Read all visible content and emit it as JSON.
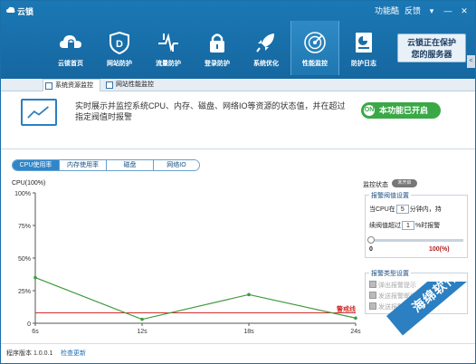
{
  "app": {
    "title": "云锁"
  },
  "titlebar": {
    "feature_menu": "功能酷",
    "feedback": "反馈",
    "minimize": "—",
    "close": "✕",
    "menu": "▾"
  },
  "nav": [
    {
      "label": "云锁首页",
      "icon": "cloud-lock-icon"
    },
    {
      "label": "网站防护",
      "icon": "shield-d-icon"
    },
    {
      "label": "流量防护",
      "icon": "traffic-icon"
    },
    {
      "label": "登录防护",
      "icon": "padlock-icon"
    },
    {
      "label": "系统优化",
      "icon": "rocket-icon"
    },
    {
      "label": "性能监控",
      "icon": "radar-icon",
      "active": true
    },
    {
      "label": "防护日志",
      "icon": "log-icon"
    }
  ],
  "protect_status": {
    "line1": "云锁正在保护",
    "line2": "您的服务器"
  },
  "side_tab": "<",
  "subtabs": [
    {
      "label": "系统资源监控",
      "active": true
    },
    {
      "label": "网站性能监控",
      "active": false
    }
  ],
  "banner": {
    "description": "实时展示并监控系统CPU、内存、磁盘、网络IO等资源的状态值，并在超过指定阀值时报警",
    "enable_button": "本功能已开启",
    "enable_icon_text": "ON"
  },
  "metric_tabs": [
    {
      "label": "CPU使用率",
      "active": true
    },
    {
      "label": "内存使用率",
      "active": false
    },
    {
      "label": "磁盘",
      "active": false
    },
    {
      "label": "网络IO",
      "active": false
    }
  ],
  "chart_data": {
    "type": "line",
    "title": "CPU(100%)",
    "x_labels": [
      "6s",
      "12s",
      "18s",
      "24s"
    ],
    "y_ticks": [
      "100%",
      "75%",
      "50%",
      "25%",
      "0"
    ],
    "ylim": [
      0,
      100
    ],
    "series": [
      {
        "values": [
          35,
          3,
          22,
          4
        ],
        "color": "#3d9a3d"
      }
    ],
    "threshold": {
      "value": 8,
      "label": "警戒线",
      "color": "#d03030"
    }
  },
  "right_panel": {
    "monitor_status_label": "监控状态",
    "monitor_toggle": "未开启",
    "alarm_threshold_title": "报警阀值设置",
    "row1_prefix": "当CPU在",
    "row1_value": "5",
    "row1_suffix": "分钟内，持",
    "row2_prefix": "续阀值超过",
    "row2_value": "1",
    "row2_suffix": "%时报警",
    "slider_value": 0,
    "slider_min_label": "0",
    "slider_max_label": "100(%)",
    "alarm_type_title": "报警类型设置",
    "alarm_types": [
      "弹出报警提示",
      "发送报警邮件",
      "发送报警短信"
    ]
  },
  "footer": {
    "version": "程序版本 1.0.0.1",
    "check_update": "检查更新"
  },
  "watermark": {
    "text": "海绵软件"
  },
  "colors": {
    "header": "#1a72ae",
    "accent": "#2f86c8",
    "enabled": "#3aa846",
    "threshold": "#d03030",
    "series": "#3d9a3d"
  }
}
